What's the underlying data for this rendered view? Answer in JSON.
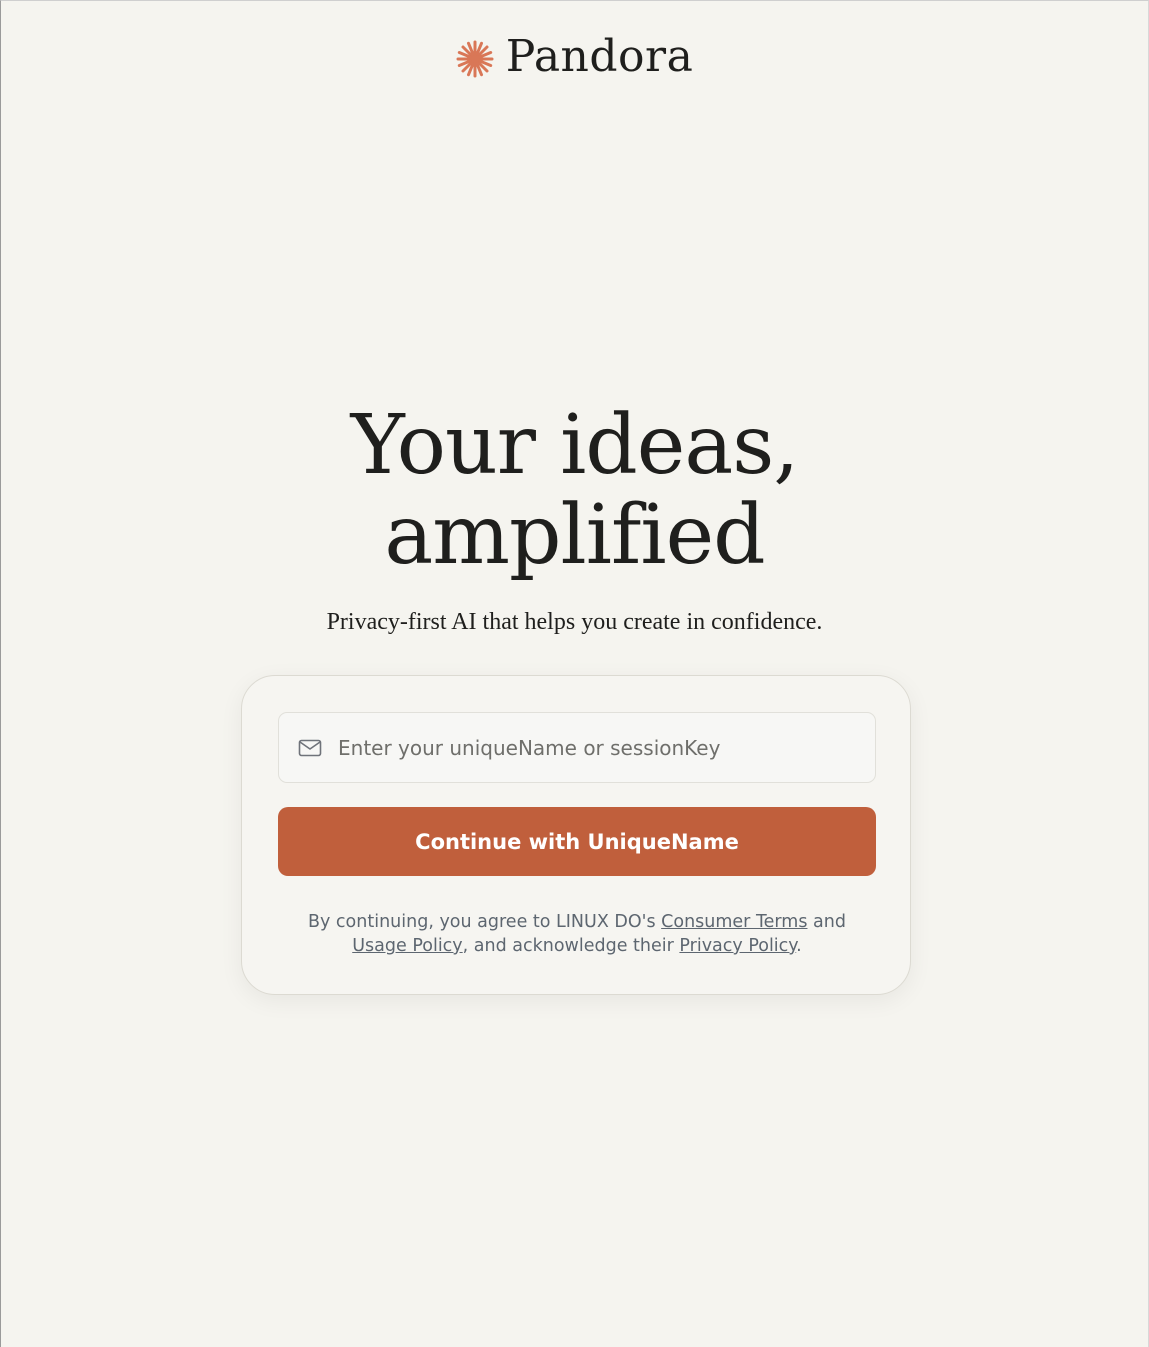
{
  "header": {
    "brand_name": "Pandora",
    "logo_icon": "starburst-icon",
    "accent_color": "#d97757"
  },
  "hero": {
    "headline_line1": "Your ideas,",
    "headline_line2": "amplified",
    "subtitle": "Privacy-first AI that helps you create in confidence."
  },
  "login": {
    "input_icon": "mail-icon",
    "input_value": "",
    "input_placeholder": "Enter your uniqueName or sessionKey",
    "button_label": "Continue with UniqueName",
    "button_color": "#c05f3c"
  },
  "legal": {
    "prefix": "By continuing, you agree to LINUX DO's ",
    "consumer_terms": "Consumer Terms",
    "and": " and ",
    "usage_policy": "Usage Policy",
    "middle": ", and acknowledge their ",
    "privacy_policy": "Privacy Policy",
    "suffix": "."
  }
}
